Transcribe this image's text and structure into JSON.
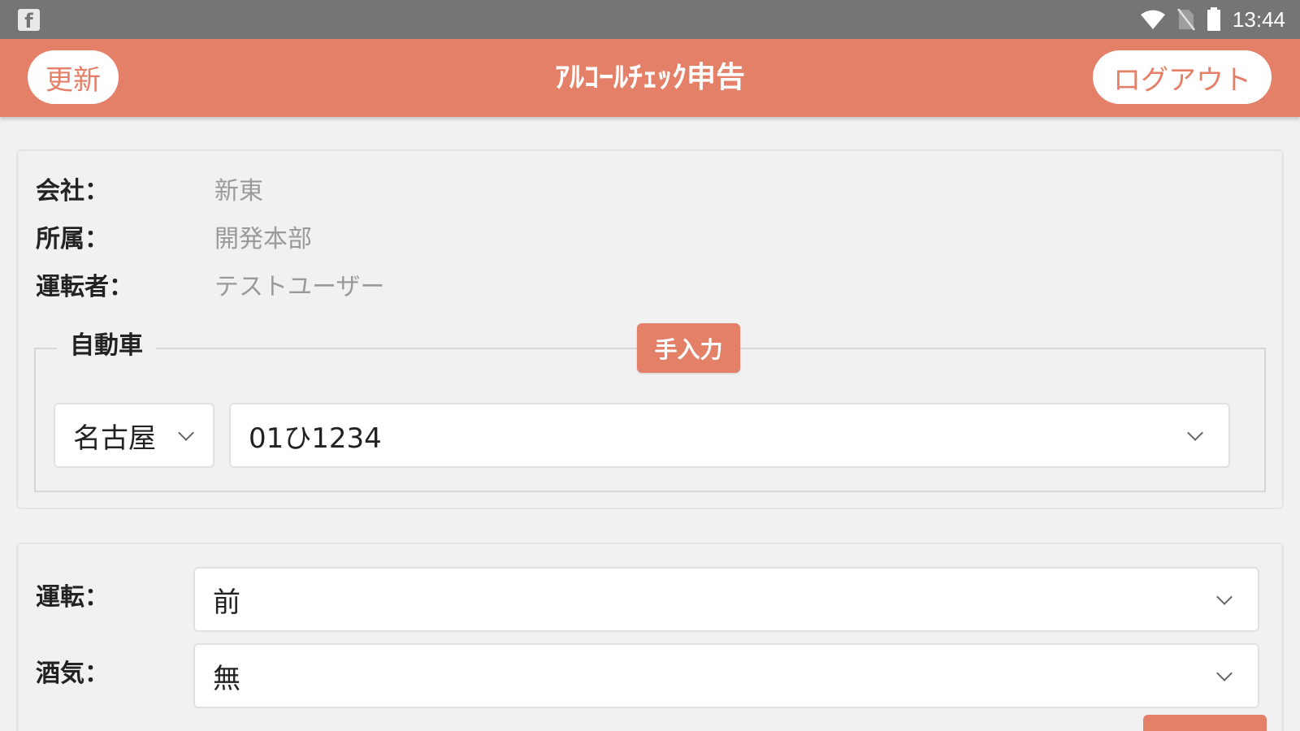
{
  "status_bar": {
    "notification_icon": "facebook-icon",
    "time": "13:44",
    "icons": [
      "wifi-icon",
      "no-sim-icon",
      "battery-icon"
    ]
  },
  "app_bar": {
    "title": "ｱﾙｺｰﾙﾁｪｯｸ申告",
    "update_label": "更新",
    "logout_label": "ログアウト"
  },
  "info": {
    "company_label": "会社：",
    "company_value": "新東",
    "department_label": "所属：",
    "department_value": "開発本部",
    "driver_label": "運転者：",
    "driver_value": "テストユーザー"
  },
  "vehicle": {
    "legend": "自動車",
    "manual_input_label": "手入力",
    "region_value": "名古屋",
    "plate_value": "01ひ1234"
  },
  "check": {
    "driving_label": "運転：",
    "driving_value": "前",
    "alcohol_label": "酒気：",
    "alcohol_value": "無"
  },
  "colors": {
    "accent": "#e47f68",
    "status_bar": "#757575",
    "background": "#f1f1f1"
  }
}
